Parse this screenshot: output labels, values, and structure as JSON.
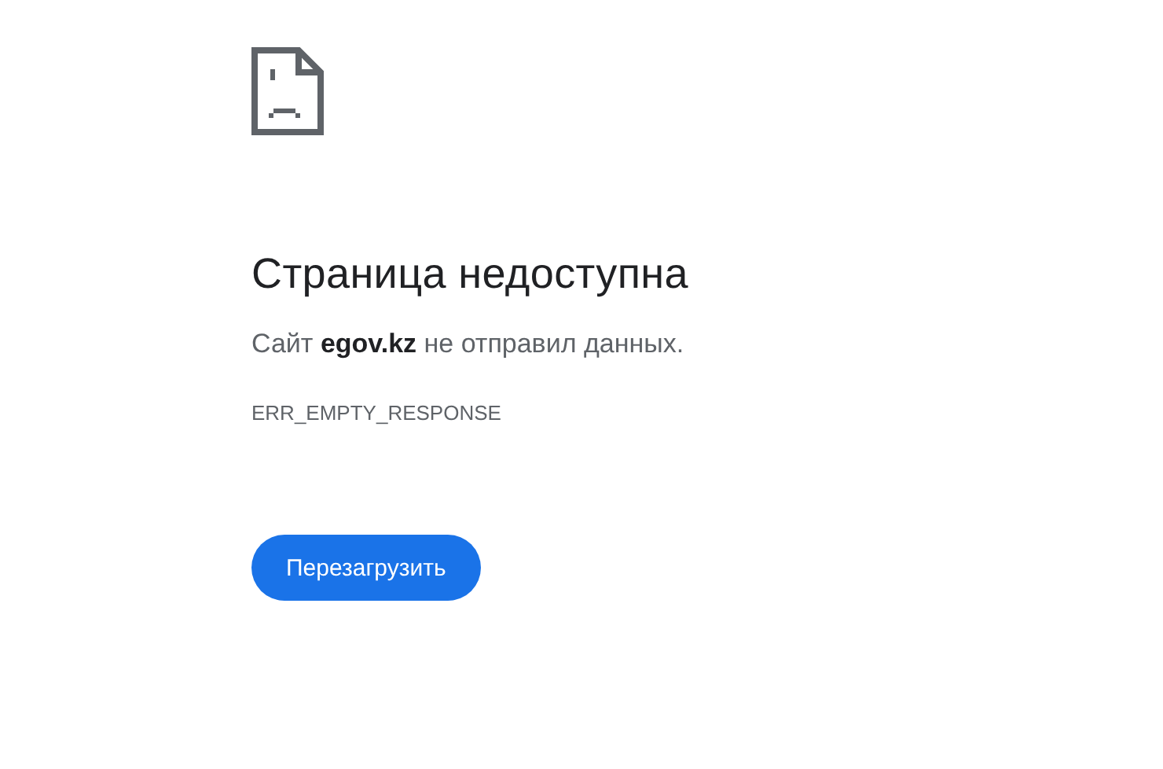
{
  "heading": "Страница недоступна",
  "message": "Сайт **egov.kz** не отправил данных.",
  "error_code": "ERR_EMPTY_RESPONSE",
  "reload_button": {
    "label": "Перезагрузить"
  }
}
